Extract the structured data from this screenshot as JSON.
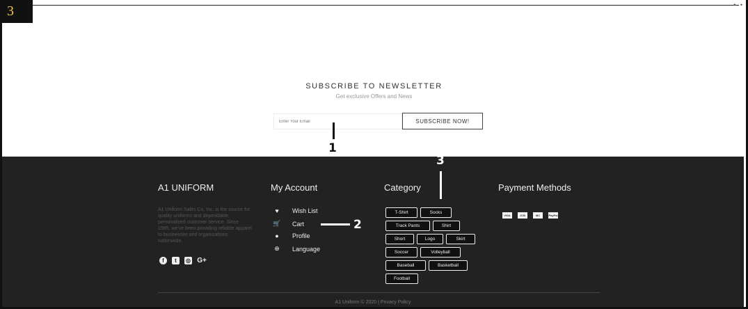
{
  "badge": "3",
  "newsletter": {
    "title": "SUBSCRIBE TO NEWSLETTER",
    "subtitle": "Get exclusive Offers and News",
    "email_placeholder": "Enter Your Email",
    "button_label": "SUBSCRIBE NOW!"
  },
  "annotations": {
    "one": "1",
    "two": "2",
    "three": "3"
  },
  "footer": {
    "brand": {
      "title": "A1 UNIFORM",
      "about": "A1 Uniform Sales Co, Inc. is the source for quality uniforms and dependable, personalized customer service. Since 1985, we've been providing reliable apparel to businesses and organizations nationwide.",
      "social": [
        "facebook-icon",
        "twitter-icon",
        "instagram-icon",
        "google-plus-icon"
      ],
      "gplus_glyph": "G+"
    },
    "account": {
      "title": "My Account",
      "items": [
        {
          "label": "Wish List",
          "icon": "heart-icon"
        },
        {
          "label": "Cart",
          "icon": "cart-icon"
        },
        {
          "label": "Profile",
          "icon": "user-icon"
        },
        {
          "label": "Language",
          "icon": "globe-icon"
        }
      ]
    },
    "category": {
      "title": "Category",
      "tags": [
        "T-Shirt",
        "Socks",
        "Track Pants",
        "Shirt",
        "Short",
        "Logo",
        "Skirt",
        "Soccer",
        "Volleyball",
        "Baseball",
        "Basketball",
        "Football"
      ]
    },
    "payment": {
      "title": "Payment Methods",
      "methods": [
        "VISA",
        "JCB",
        "MC",
        "PayPal"
      ]
    },
    "copyright": "A1 Uniform © 2020 | Privacy Policy"
  }
}
